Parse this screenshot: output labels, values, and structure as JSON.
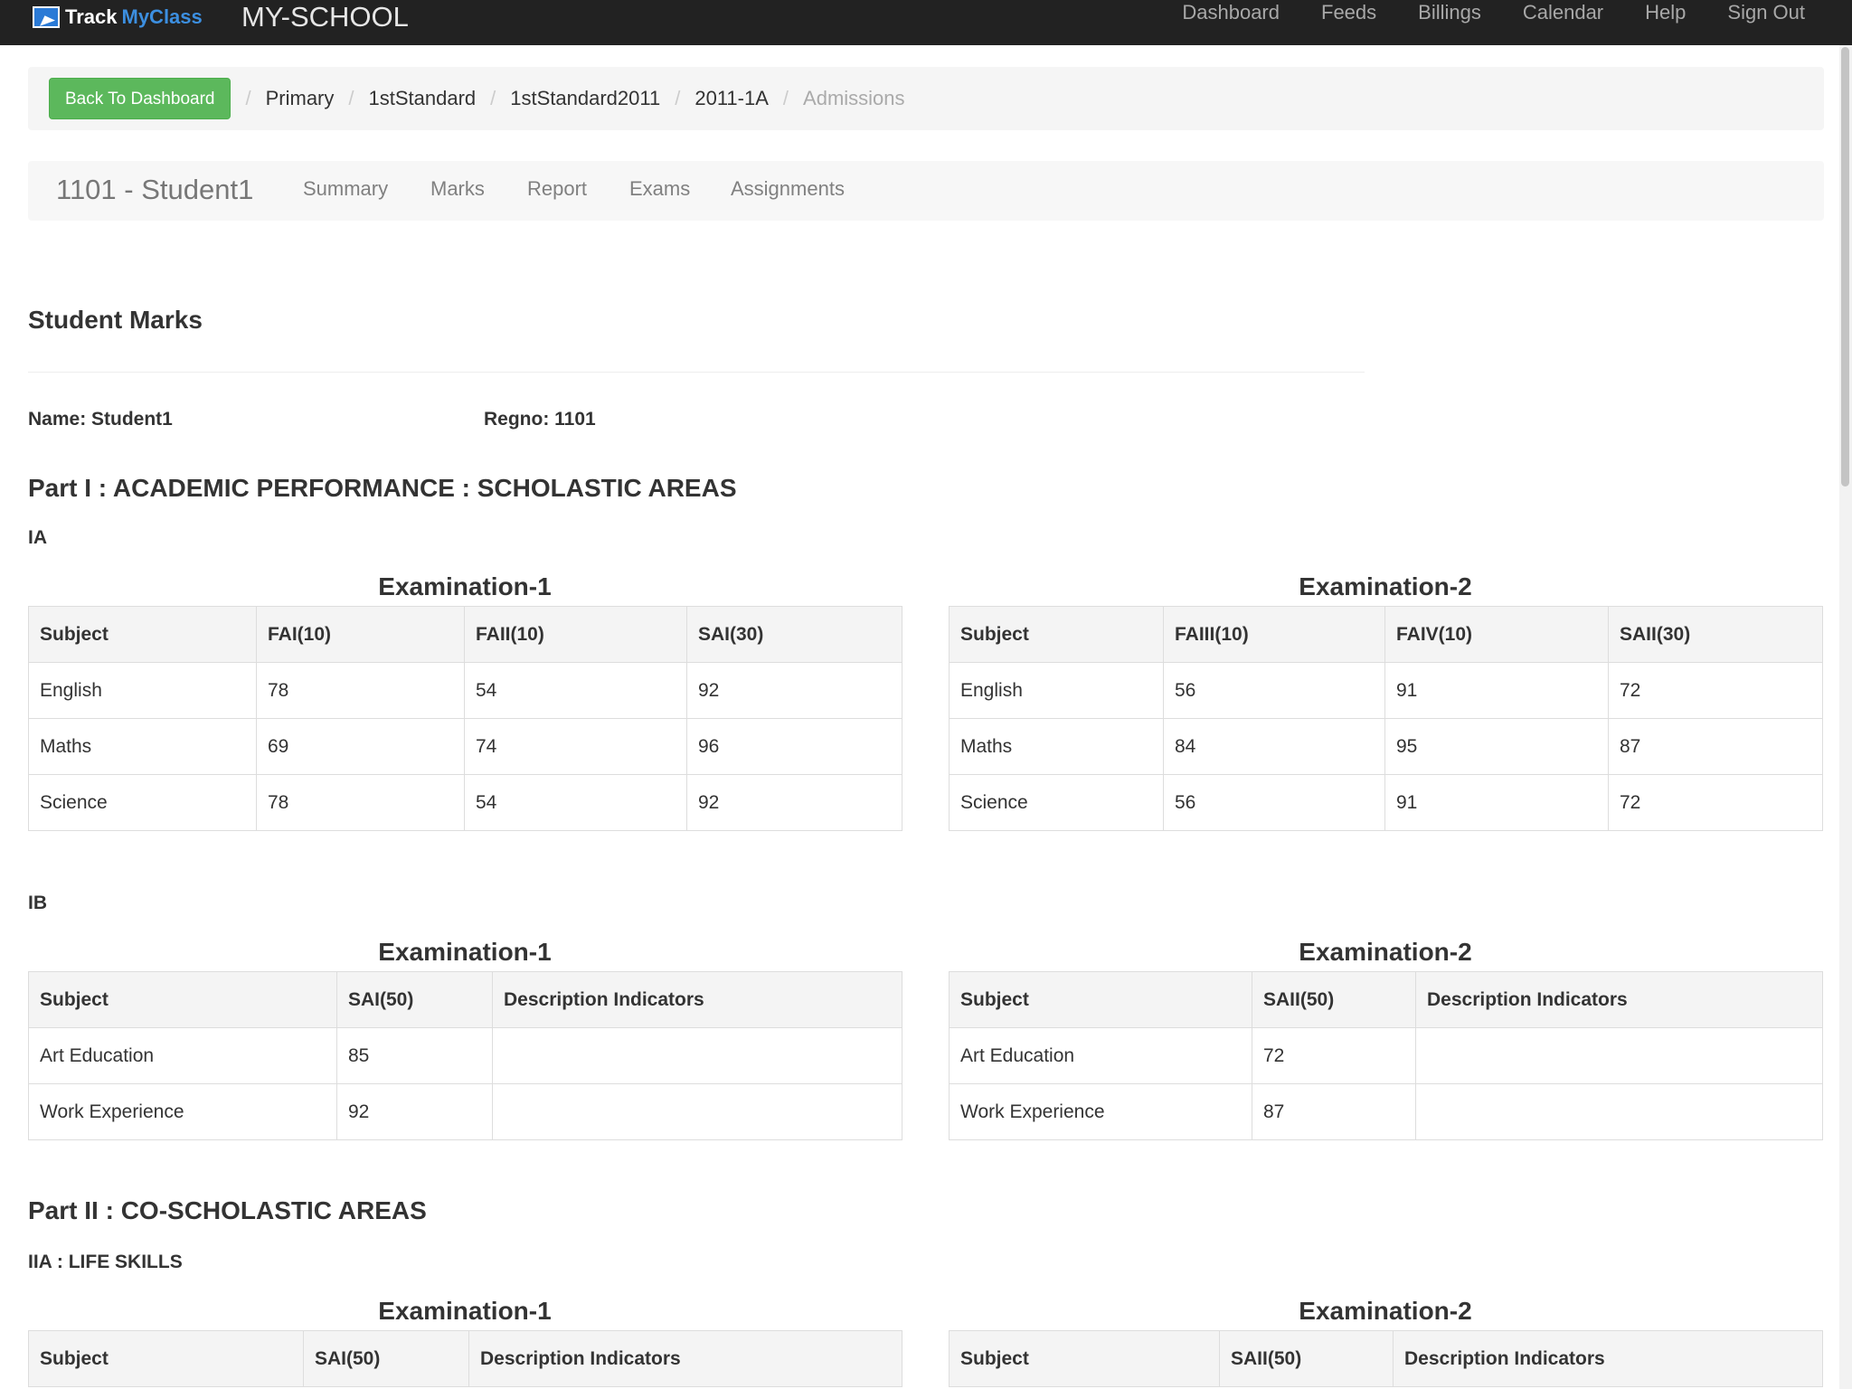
{
  "navbar": {
    "logo_text_track": "Track",
    "logo_text_myclass": "MyClass",
    "brand": "MY-SCHOOL",
    "links": [
      "Dashboard",
      "Feeds",
      "Billings",
      "Calendar",
      "Help",
      "Sign Out"
    ]
  },
  "breadcrumb": {
    "back_button": "Back To Dashboard",
    "items": [
      "Primary",
      "1stStandard",
      "1stStandard2011",
      "2011-1A"
    ],
    "active": "Admissions",
    "separator": "/"
  },
  "student_nav": {
    "title": "1101 - Student1",
    "tabs": [
      "Summary",
      "Marks",
      "Report",
      "Exams",
      "Assignments"
    ]
  },
  "page": {
    "heading": "Student Marks",
    "name_label": "Name: Student1",
    "regno_label": "Regno: 1101",
    "part1": "Part I : ACADEMIC PERFORMANCE : SCHOLASTIC AREAS",
    "part1_ia": "IA",
    "part1_ib": "IB",
    "part2": "Part II : CO-SCHOLASTIC AREAS",
    "part2_iia": "IIA : LIFE SKILLS"
  },
  "ia": {
    "exam1": {
      "title": "Examination-1",
      "headers": [
        "Subject",
        "FAI(10)",
        "FAII(10)",
        "SAI(30)"
      ],
      "rows": [
        [
          "English",
          "78",
          "54",
          "92"
        ],
        [
          "Maths",
          "69",
          "74",
          "96"
        ],
        [
          "Science",
          "78",
          "54",
          "92"
        ]
      ]
    },
    "exam2": {
      "title": "Examination-2",
      "headers": [
        "Subject",
        "FAIII(10)",
        "FAIV(10)",
        "SAII(30)"
      ],
      "rows": [
        [
          "English",
          "56",
          "91",
          "72"
        ],
        [
          "Maths",
          "84",
          "95",
          "87"
        ],
        [
          "Science",
          "56",
          "91",
          "72"
        ]
      ]
    }
  },
  "ib": {
    "exam1": {
      "title": "Examination-1",
      "headers": [
        "Subject",
        "SAI(50)",
        "Description Indicators"
      ],
      "rows": [
        [
          "Art Education",
          "85",
          ""
        ],
        [
          "Work Experience",
          "92",
          ""
        ]
      ]
    },
    "exam2": {
      "title": "Examination-2",
      "headers": [
        "Subject",
        "SAII(50)",
        "Description Indicators"
      ],
      "rows": [
        [
          "Art Education",
          "72",
          ""
        ],
        [
          "Work Experience",
          "87",
          ""
        ]
      ]
    }
  },
  "iia": {
    "exam1": {
      "title": "Examination-1",
      "headers": [
        "Subject",
        "SAI(50)",
        "Description Indicators"
      ]
    },
    "exam2": {
      "title": "Examination-2",
      "headers": [
        "Subject",
        "SAII(50)",
        "Description Indicators"
      ]
    }
  },
  "colors": {
    "navbar_bg": "#222222",
    "back_button": "#5cb85c",
    "logo_accent": "#3c8fe0"
  }
}
